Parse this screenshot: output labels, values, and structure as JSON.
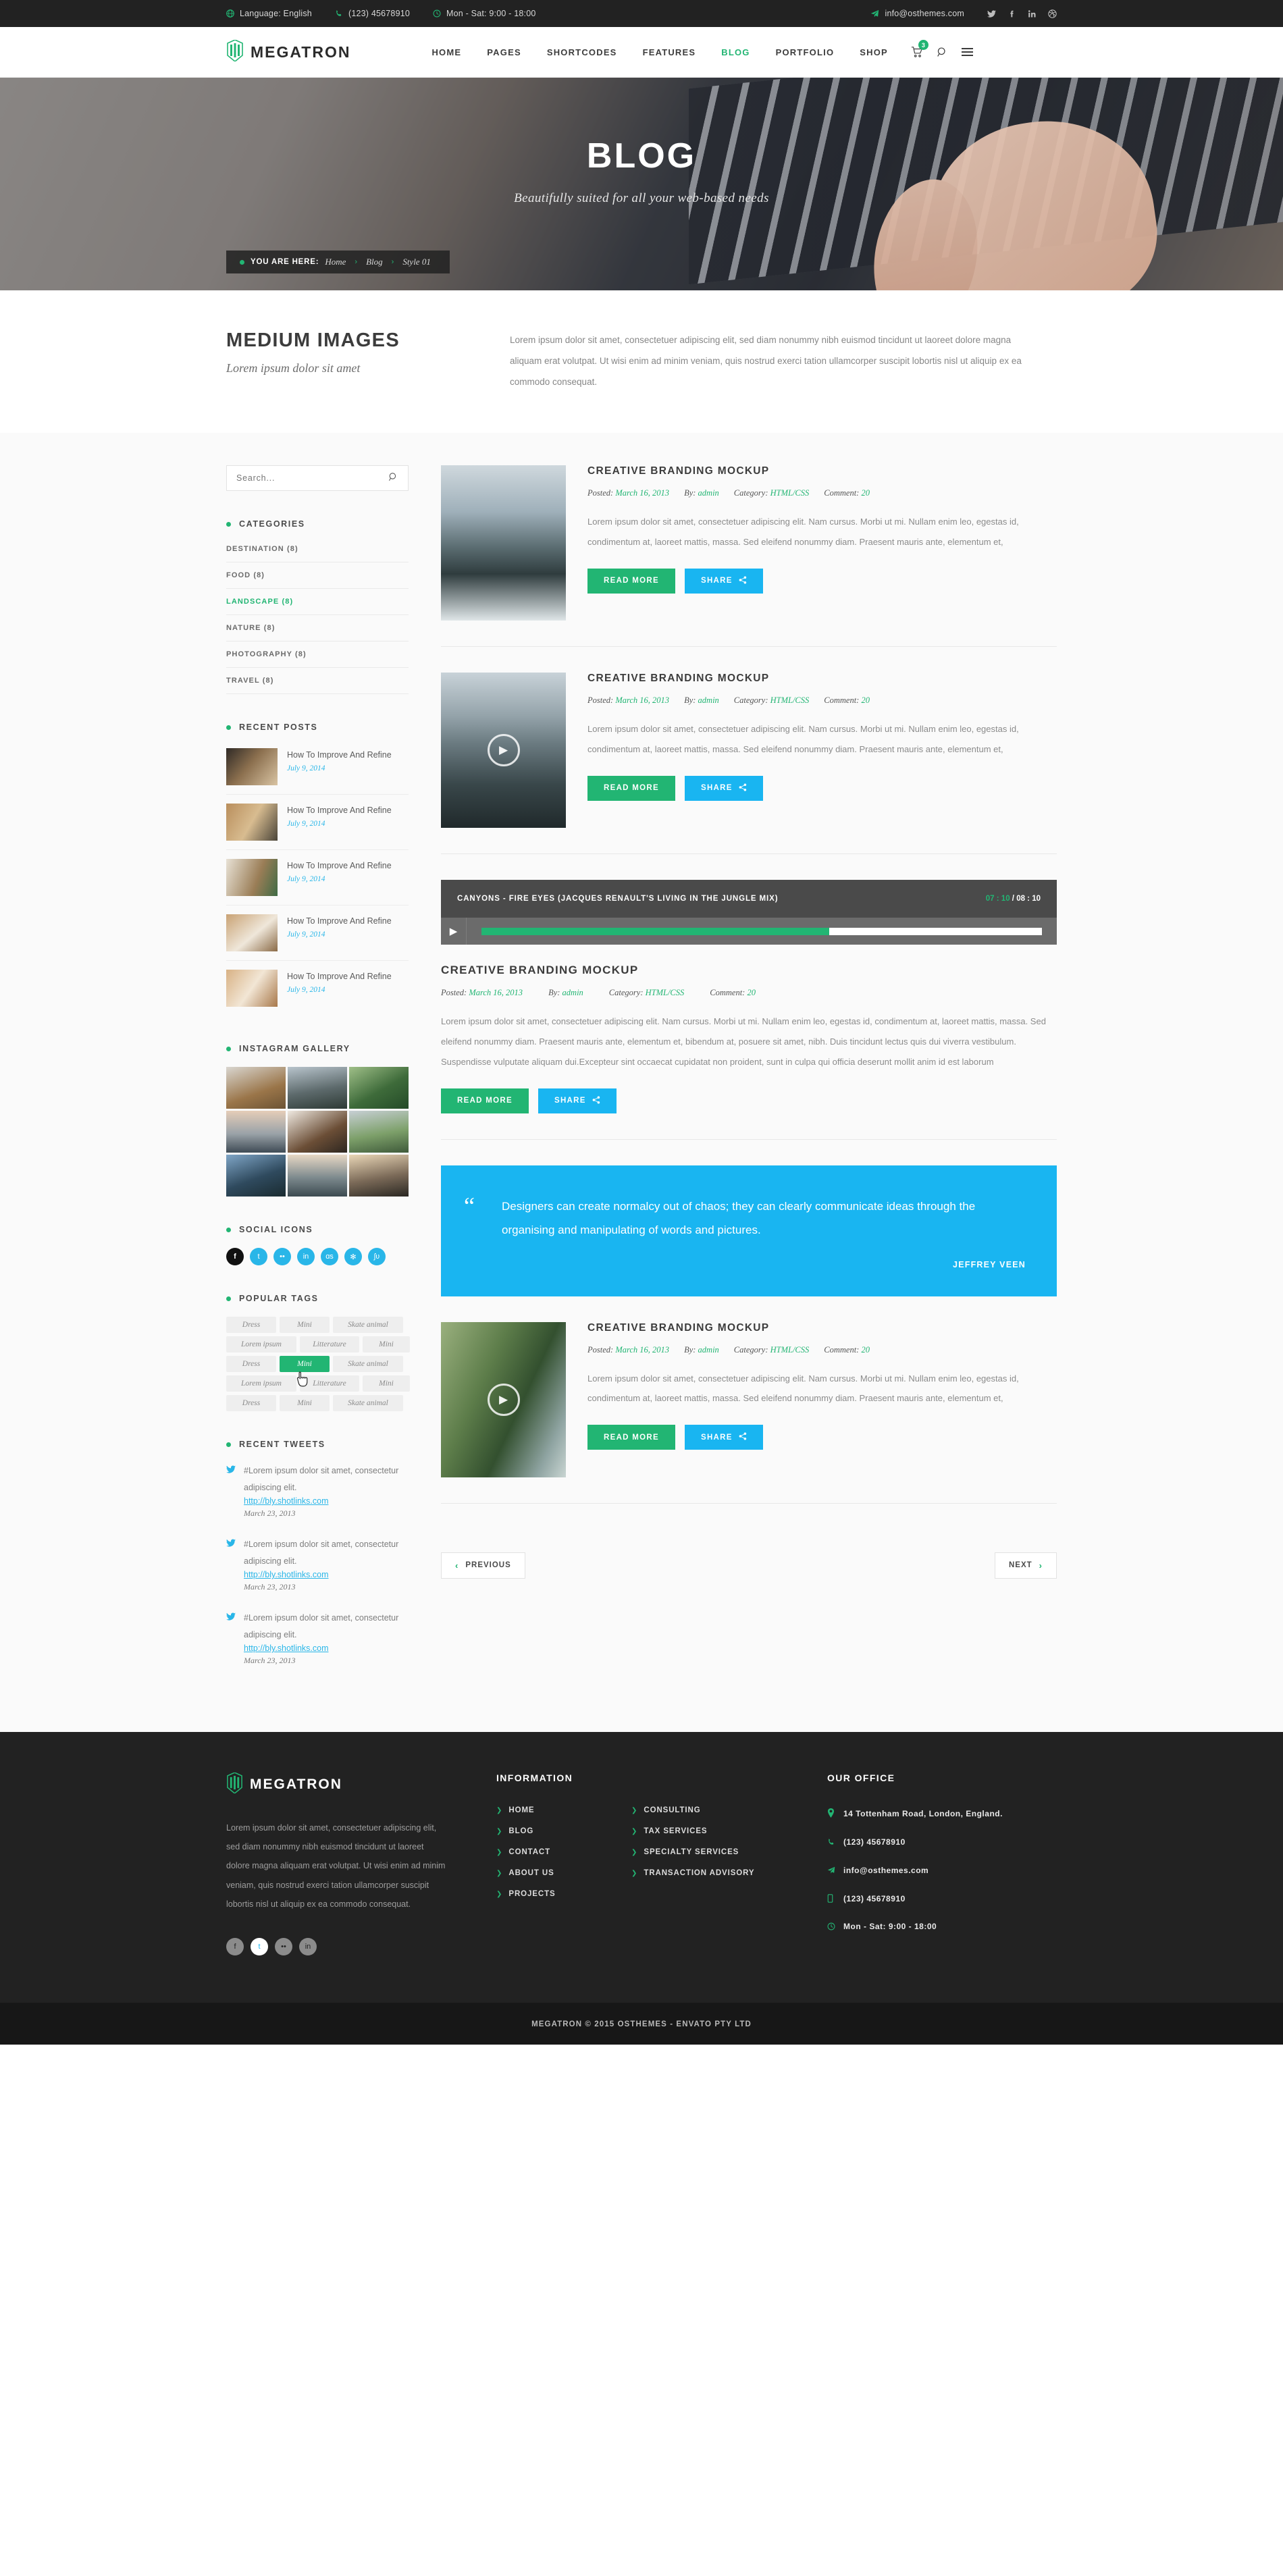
{
  "topbar": {
    "language": "Language: English",
    "phone": "(123) 45678910",
    "hours": "Mon - Sat: 9:00 - 18:00",
    "email": "info@osthemes.com",
    "social": [
      "twitter-icon",
      "facebook-icon",
      "linkedin-icon",
      "dribbble-icon"
    ]
  },
  "header": {
    "brand": "MEGATRON",
    "nav": [
      {
        "label": "HOME",
        "active": false
      },
      {
        "label": "PAGES",
        "active": false
      },
      {
        "label": "SHORTCODES",
        "active": false
      },
      {
        "label": "FEATURES",
        "active": false
      },
      {
        "label": "BLOG",
        "active": true
      },
      {
        "label": "PORTFOLIO",
        "active": false
      },
      {
        "label": "SHOP",
        "active": false
      }
    ],
    "cart_count": "3"
  },
  "hero": {
    "title": "BLOG",
    "subtitle": "Beautifully suited for all your web-based needs",
    "breadcrumb_label": "YOU ARE HERE:",
    "breadcrumb": [
      "Home",
      "Blog",
      "Style 01"
    ]
  },
  "intro": {
    "heading": "MEDIUM IMAGES",
    "subheading": "Lorem ipsum dolor sit amet",
    "body": "Lorem ipsum dolor sit amet, consectetuer adipiscing elit, sed diam nonummy nibh euismod tincidunt ut laoreet dolore magna aliquam erat volutpat. Ut wisi enim ad minim veniam, quis nostrud exerci tation ullamcorper suscipit lobortis nisl ut aliquip ex ea commodo consequat."
  },
  "sidebar": {
    "search_placeholder": "Search...",
    "categories_title": "CATEGORIES",
    "categories": [
      {
        "label": "DESTINATION (8)",
        "active": false
      },
      {
        "label": "FOOD (8)",
        "active": false
      },
      {
        "label": "LANDSCAPE (8)",
        "active": true
      },
      {
        "label": "NATURE (8)",
        "active": false
      },
      {
        "label": "PHOTOGRAPHY (8)",
        "active": false
      },
      {
        "label": "TRAVEL (8)",
        "active": false
      }
    ],
    "recent_posts_title": "RECENT POSTS",
    "recent_posts": [
      {
        "title": "How To Improve And Refine",
        "date": "July 9, 2014"
      },
      {
        "title": "How To Improve And Refine",
        "date": "July 9, 2014"
      },
      {
        "title": "How To Improve And Refine",
        "date": "July 9, 2014"
      },
      {
        "title": "How To Improve And Refine",
        "date": "July 9, 2014"
      },
      {
        "title": "How To Improve And Refine",
        "date": "July 9, 2014"
      }
    ],
    "instagram_title": "INSTAGRAM GALLERY",
    "social_title": "SOCIAL ICONS",
    "social_icons": [
      "facebook-icon",
      "twitter-icon",
      "flickr-icon",
      "linkedin-icon",
      "lastfm-icon",
      "dribbble-icon",
      "stumbleupon-icon"
    ],
    "tags_title": "POPULAR TAGS",
    "tag_rows": [
      [
        {
          "label": "Dress",
          "active": false
        },
        {
          "label": "Mini",
          "active": false
        },
        {
          "label": "Skate animal",
          "active": false
        }
      ],
      [
        {
          "label": "Lorem ipsum",
          "active": false
        },
        {
          "label": "Litterature",
          "active": false
        },
        {
          "label": "Mini",
          "active": false
        }
      ],
      [
        {
          "label": "Dress",
          "active": false
        },
        {
          "label": "Mini",
          "active": true
        },
        {
          "label": "Skate animal",
          "active": false
        }
      ],
      [
        {
          "label": "Lorem ipsum",
          "active": false
        },
        {
          "label": "Litterature",
          "active": false
        },
        {
          "label": "Mini",
          "active": false
        }
      ],
      [
        {
          "label": "Dress",
          "active": false
        },
        {
          "label": "Mini",
          "active": false
        },
        {
          "label": "Skate animal",
          "active": false
        }
      ]
    ],
    "tweets_title": "RECENT TWEETS",
    "tweets": [
      {
        "text": "#Lorem ipsum dolor sit amet, consectetur adipiscing elit.",
        "link": "http://bly.shotlinks.com",
        "date": "March 23, 2013"
      },
      {
        "text": "#Lorem ipsum dolor sit amet, consectetur adipiscing elit.",
        "link": "http://bly.shotlinks.com",
        "date": "March 23, 2013"
      },
      {
        "text": "#Lorem ipsum dolor sit amet, consectetur adipiscing elit.",
        "link": "http://bly.shotlinks.com",
        "date": "March 23, 2013"
      }
    ]
  },
  "posts": {
    "meta_labels": {
      "posted": "Posted:",
      "by": "By:",
      "category": "Category:",
      "comment": "Comment:"
    },
    "read_more": "READ MORE",
    "share": "SHARE",
    "post1": {
      "title": "CREATIVE BRANDING MOCKUP",
      "date": "March 16, 2013",
      "author": "admin",
      "category": "HTML/CSS",
      "comments": "20",
      "text": "Lorem ipsum dolor sit amet, consectetuer adipiscing elit. Nam cursus. Morbi ut mi. Nullam enim leo, egestas id, condimentum at, laoreet mattis, massa. Sed eleifend nonummy diam. Praesent mauris ante, elementum et,"
    },
    "post2": {
      "title": "CREATIVE BRANDING MOCKUP",
      "date": "March 16, 2013",
      "author": "admin",
      "category": "HTML/CSS",
      "comments": "20",
      "text": "Lorem ipsum dolor sit amet, consectetuer adipiscing elit. Nam cursus. Morbi ut mi. Nullam enim leo, egestas id, condimentum at, laoreet mattis, massa. Sed eleifend nonummy diam. Praesent mauris ante, elementum et,"
    },
    "audio": {
      "track": "CANYONS - FIRE EYES (JACQUES RENAULT'S LIVING IN THE JUNGLE MIX)",
      "current": "07 : 10",
      "total": "08 : 10",
      "progress": "62"
    },
    "post3": {
      "title": "CREATIVE BRANDING MOCKUP",
      "date": "March 16, 2013",
      "author": "admin",
      "category": "HTML/CSS",
      "comments": "20",
      "text": "Lorem ipsum dolor sit amet, consectetuer adipiscing elit. Nam cursus. Morbi ut mi. Nullam enim leo, egestas id, condimentum at, laoreet mattis, massa. Sed eleifend nonummy diam. Praesent mauris ante, elementum et, bibendum at, posuere sit amet, nibh. Duis tincidunt lectus quis dui viverra vestibulum. Suspendisse vulputate aliquam dui.Excepteur sint occaecat cupidatat non proident, sunt in culpa qui officia deserunt mollit anim id est laborum"
    },
    "quote": {
      "text": "Designers can create normalcy out of chaos; they can clearly communicate ideas through the organising and manipulating of words and pictures.",
      "author": "JEFFREY VEEN"
    },
    "post4": {
      "title": "CREATIVE BRANDING MOCKUP",
      "date": "March 16, 2013",
      "author": "admin",
      "category": "HTML/CSS",
      "comments": "20",
      "text": "Lorem ipsum dolor sit amet, consectetuer adipiscing elit. Nam cursus. Morbi ut mi. Nullam enim leo, egestas id, condimentum at, laoreet mattis, massa. Sed eleifend nonummy diam. Praesent mauris ante, elementum et,"
    },
    "pager": {
      "previous": "PREVIOUS",
      "next": "NEXT"
    }
  },
  "footer": {
    "brand": "MEGATRON",
    "about": "Lorem ipsum dolor sit amet, consectetuer adipiscing elit, sed diam nonummy nibh euismod tincidunt ut laoreet dolore magna aliquam erat volutpat. Ut wisi enim ad minim veniam, quis nostrud exerci tation ullamcorper suscipit lobortis nisl ut aliquip ex ea commodo consequat.",
    "social": [
      "facebook-icon",
      "twitter-icon",
      "flickr-icon",
      "linkedin-icon"
    ],
    "info_title": "INFORMATION",
    "info_links": [
      "HOME",
      "BLOG",
      "CONTACT",
      "ABOUT US",
      "PROJECTS"
    ],
    "service_links": [
      "CONSULTING",
      "TAX SERVICES",
      "SPECIALTY SERVICES",
      "TRANSACTION ADVISORY"
    ],
    "office_title": "OUR OFFICE",
    "office": [
      {
        "icon": "map-pin-icon",
        "text": "14 Tottenham Road, London, England."
      },
      {
        "icon": "phone-icon",
        "text": "(123) 45678910"
      },
      {
        "icon": "send-icon",
        "text": "info@osthemes.com"
      },
      {
        "icon": "mobile-icon",
        "text": "(123) 45678910"
      },
      {
        "icon": "clock-icon",
        "text": "Mon - Sat: 9:00 - 18:00"
      }
    ],
    "copyright": "MEGATRON © 2015 OSTHEMES - ENVATO PTY LTD"
  },
  "colors": {
    "green": "#22b573",
    "blue": "#19b5f1",
    "dark": "#222222"
  }
}
